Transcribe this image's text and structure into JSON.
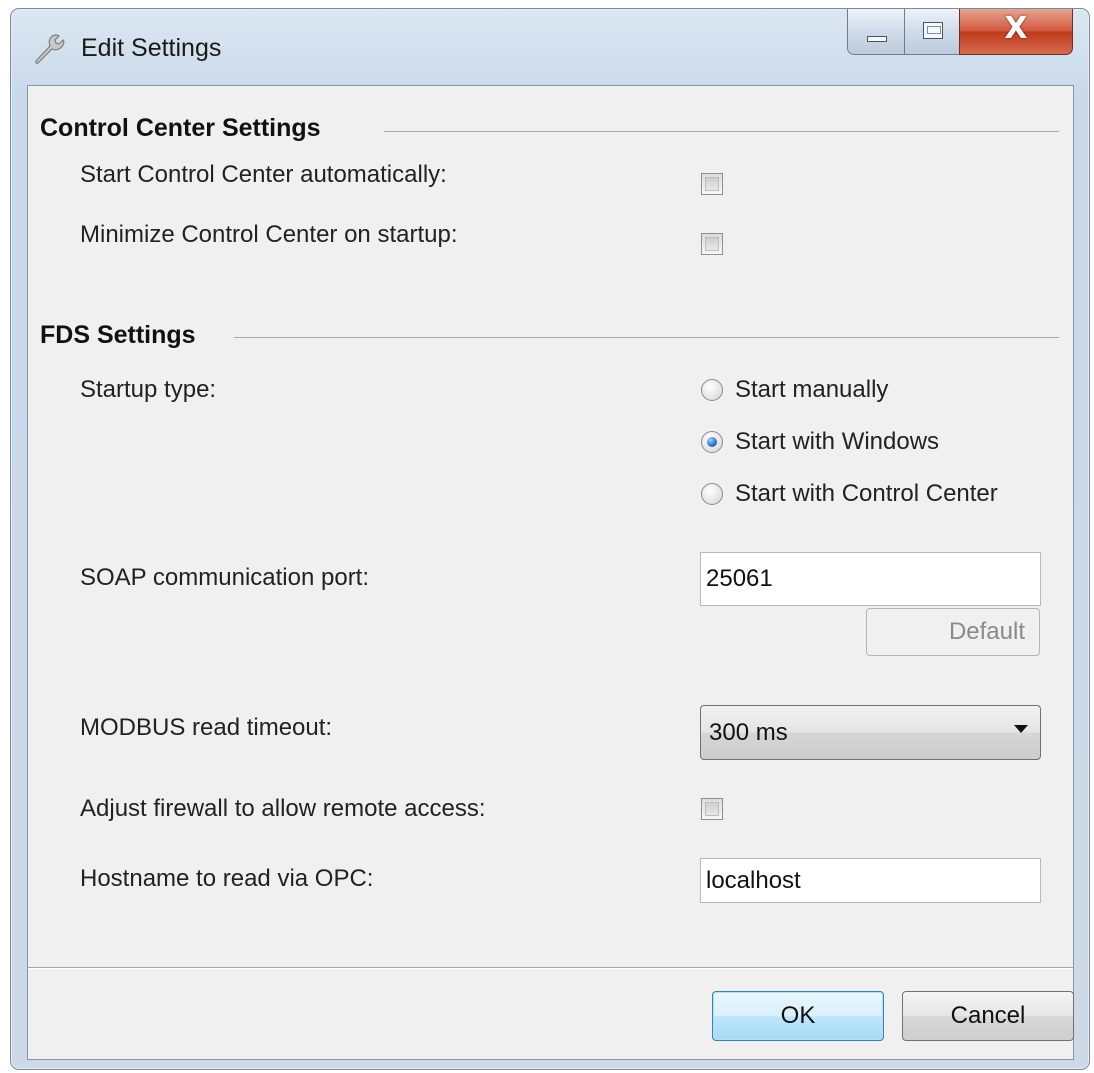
{
  "window": {
    "title": "Edit Settings",
    "icon": "wrench-icon",
    "close_glyph": "X"
  },
  "control_center": {
    "header": "Control Center Settings",
    "start_auto_label": "Start Control Center automatically:",
    "start_auto_checked": false,
    "minimize_label": "Minimize Control Center on startup:",
    "minimize_checked": false
  },
  "fds": {
    "header": "FDS Settings",
    "startup_label": "Startup type:",
    "startup_options": [
      "Start manually",
      "Start with Windows",
      "Start with Control Center"
    ],
    "startup_selected": "Start with Windows",
    "soap_label": "SOAP communication port:",
    "soap_value": "25061",
    "default_button": "Default",
    "modbus_label": "MODBUS read timeout:",
    "modbus_value": "300 ms",
    "firewall_label": "Adjust firewall to allow remote access:",
    "firewall_checked": false,
    "hostname_label": "Hostname to read via OPC:",
    "hostname_value": "localhost"
  },
  "footer": {
    "ok_label": "OK",
    "cancel_label": "Cancel"
  },
  "colors": {
    "close_button": "#c9472b",
    "radio_selected": "#1b63b8",
    "default_button_border": "#3c7fb1"
  }
}
